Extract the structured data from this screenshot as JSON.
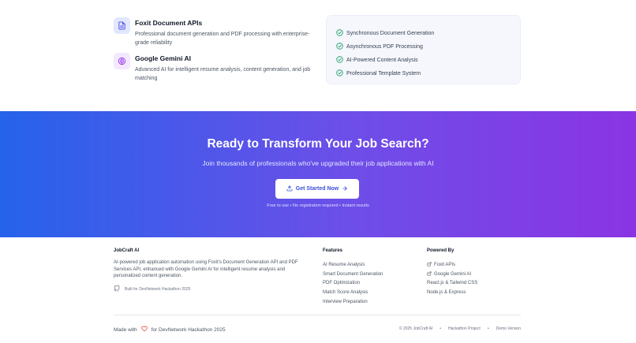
{
  "integrations": {
    "foxit": {
      "icon": "document-icon",
      "title": "Foxit Document APIs",
      "description": "Professional document generation and PDF processing with enterprise-grade reliability"
    },
    "gemini": {
      "icon": "brain-icon",
      "title": "Google Gemini AI",
      "description": "Advanced AI for intelligent resume analysis, content generation, and job matching"
    },
    "checklist": [
      "Synchronous Document Generation",
      "Asynchronous PDF Processing",
      "AI-Powered Content Analysis",
      "Professional Template System"
    ]
  },
  "cta": {
    "heading": "Ready to Transform Your Job Search?",
    "subheading": "Join thousands of professionals who've upgraded their job applications with AI",
    "button_label": "Get Started Now",
    "note": "Free to use • No registration required • Instant results"
  },
  "footer": {
    "brand": "JobCraft AI",
    "about": "AI-powered job application automation using Foxit's Document Generation API and PDF Services API, enhanced with Google Gemini AI for intelligent resume analysis and personalized content generation.",
    "built_for": "Built for DevNetwork Hackathon 2025",
    "features_heading": "Features",
    "features": [
      "AI Resume Analysis",
      "Smart Document Generation",
      "PDF Optimization",
      "Match Score Analysis",
      "Interview Preparation"
    ],
    "powered_heading": "Powered By",
    "powered": [
      "Foxit APIs",
      "Google Gemini AI",
      "React.js & Tailwind CSS",
      "Node.js & Express"
    ],
    "made_with": "Made with",
    "made_for": "for DevNetwork Hackathon 2025",
    "copyright": "© 2025 JobCraft AI",
    "hackathon_project": "Hackathon Project",
    "demo_version": "Demo Version"
  },
  "colors": {
    "accent": "#3b4fd8",
    "check_green": "#22a06b",
    "heart_red": "#ef4444",
    "gradient_start": "#2563eb",
    "gradient_end": "#8b34e4"
  }
}
